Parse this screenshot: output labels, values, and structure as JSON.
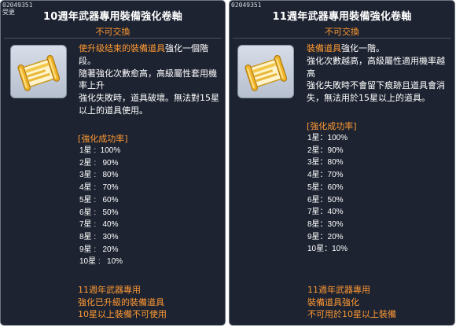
{
  "tooltips": [
    {
      "item_id": "02049351",
      "item_sub": "受更",
      "title": "10週年武器專用裝備強化卷軸",
      "untradeable": "不可交換",
      "icon": "scroll-icon",
      "desc_highlight": "使升级结束的裝備道具",
      "desc_lines": [
        "強化一個階",
        "段。",
        "隨著強化次數愈高，高級屬性套用機率上升",
        "強化失敗時，道具破壞。無法對15星以上的道具使用。"
      ],
      "rate_header": "[強化成功率]",
      "rates": [
        "1星 :  100%",
        "2星 :   90%",
        "3星 :   80%",
        "4星 :   70%",
        "5星 :   60%",
        "6星 :   50%",
        "7星 :   40%",
        "8星 :   30%",
        "9星 :   20%",
        "10星 :   10%"
      ],
      "footer": [
        "11週年武器專用",
        "強化已升級的裝備道具",
        "10星以上裝備不可使用"
      ]
    },
    {
      "item_id": "02049351",
      "title": "11週年武器專用裝備強化卷軸",
      "untradeable": "不可交換",
      "icon": "scroll-icon",
      "desc_highlight": "裝備道具",
      "desc_lines": [
        "強化一階。",
        "強化次數越高，高級屬性適用機率越高",
        "強化失敗時不會留下痕跡且道具會消失，無法用於15星以上的道具。"
      ],
      "rate_header": "[強化成功率]",
      "rates": [
        "1星：100%",
        "2星：90%",
        "3星：80%",
        "4星：70%",
        "5星：60%",
        "6星：50%",
        "7星：40%",
        "8星：30%",
        "9星：20%",
        "10星：10%"
      ],
      "footer": [
        "11週年武器專用",
        "裝備道具強化",
        "不可用於10星以上裝備"
      ]
    }
  ],
  "colors": {
    "background": "#1d2331",
    "border": "#6e7580",
    "highlight": "#ff9933",
    "text": "#ffffff"
  }
}
